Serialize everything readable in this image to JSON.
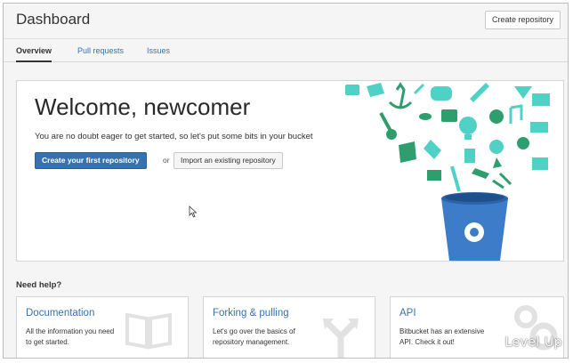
{
  "header": {
    "title": "Dashboard",
    "create_repo_label": "Create repository"
  },
  "tabs": [
    {
      "label": "Overview",
      "active": true
    },
    {
      "label": "Pull requests",
      "active": false
    },
    {
      "label": "Issues",
      "active": false
    }
  ],
  "welcome": {
    "title": "Welcome, newcomer",
    "subtitle": "You are no doubt eager to get started, so let's put some bits in your bucket",
    "primary_button": "Create your first repository",
    "or_text": "or",
    "secondary_button": "Import an existing repository"
  },
  "help": {
    "heading": "Need help?",
    "cards": [
      {
        "title": "Documentation",
        "description": "All the information you need to get started.",
        "icon": "book-icon"
      },
      {
        "title": "Forking & pulling",
        "description": "Let's go over the basics of repository management.",
        "icon": "fork-arrows-icon"
      },
      {
        "title": "API",
        "description": "Bitbucket has an extensive API. Check it out!",
        "icon": "gears-icon"
      }
    ]
  },
  "watermark": "Level Up",
  "colors": {
    "accent": "#3572b0",
    "illustration_teal": "#4fd1c5",
    "bucket_blue": "#3d7cc9",
    "illustration_green": "#2f9e6f"
  }
}
